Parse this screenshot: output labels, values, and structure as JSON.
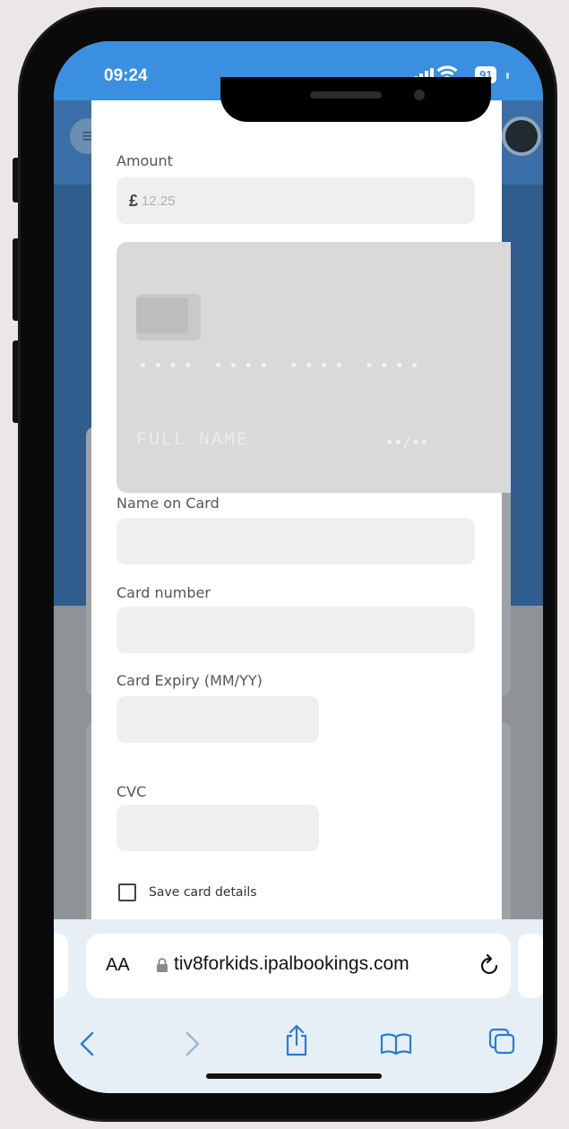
{
  "status": {
    "time": "09:24",
    "battery": "91"
  },
  "payment": {
    "amount_label": "Amount",
    "currency_symbol": "£",
    "amount_value": "12.25",
    "card_preview": {
      "number_mask": "•••• •••• •••• ••••",
      "name_placeholder": "FULL NAME",
      "expiry_mask": "••/••"
    },
    "name_label": "Name on Card",
    "card_number_label": "Card number",
    "expiry_label": "Card Expiry (MM/YY)",
    "cvc_label": "CVC",
    "save_label": "Save card details"
  },
  "browser": {
    "aa_label": "AA",
    "url": "tiv8forkids.ipalbookings.com"
  },
  "colors": {
    "status_bar": "#3a8fe0",
    "browser_bar": "#e7eff6",
    "ios_blue": "#2a7bd6"
  },
  "icons": [
    "signal-icon",
    "wifi-icon",
    "battery-icon",
    "menu-icon",
    "lock-icon",
    "reload-icon",
    "back-icon",
    "forward-icon",
    "share-icon",
    "bookmarks-icon",
    "tabs-icon"
  ]
}
